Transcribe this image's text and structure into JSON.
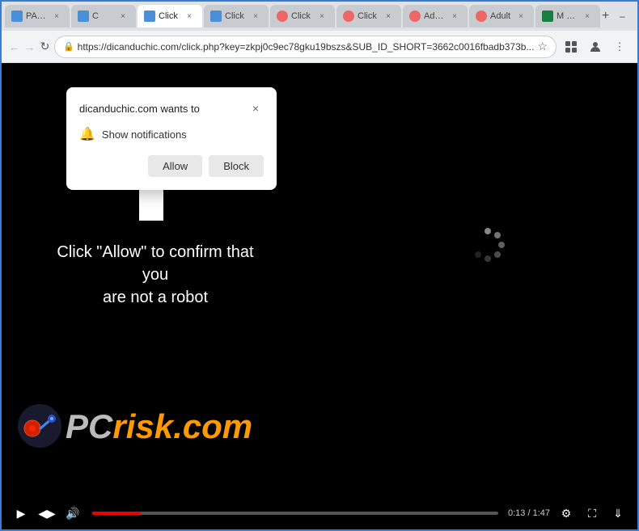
{
  "browser": {
    "tabs": [
      {
        "id": "tab1",
        "label": "PAW N...",
        "favicon_color": "#4a90d9",
        "active": false
      },
      {
        "id": "tab2",
        "label": "C",
        "favicon_color": "#4a90d9",
        "active": false
      },
      {
        "id": "tab3",
        "label": "Click",
        "favicon_color": "#4a90d9",
        "active": true
      },
      {
        "id": "tab4",
        "label": "Click",
        "favicon_color": "#4a90d9",
        "active": false
      },
      {
        "id": "tab5",
        "label": "Click",
        "favicon_color": "#e66",
        "active": false
      },
      {
        "id": "tab6",
        "label": "Click",
        "favicon_color": "#e66",
        "active": false
      },
      {
        "id": "tab7",
        "label": "Adult...",
        "favicon_color": "#e66",
        "active": false
      },
      {
        "id": "tab8",
        "label": "Adult",
        "favicon_color": "#e66",
        "active": false
      },
      {
        "id": "tab9",
        "label": "M Home...",
        "favicon_color": "#1a7f3c",
        "active": false
      }
    ],
    "address": "https://dicanduchic.com/click.php?key=zkpj0c9ec78gku19bszs&SUB_ID_SHORT=3662c0016fbadb373b...",
    "nav": {
      "back_disabled": true,
      "forward_disabled": true
    }
  },
  "popup": {
    "title": "dicanduchic.com wants to",
    "notification_label": "Show notifications",
    "allow_label": "Allow",
    "block_label": "Block"
  },
  "page": {
    "caption_line1": "Click \"Allow\" to confirm that you",
    "caption_line2": "are not a robot"
  },
  "video": {
    "time_current": "0:13",
    "time_total": "1:47",
    "progress_percent": 12
  },
  "logo": {
    "text_pc": "PC",
    "text_risk": "risk",
    "text_dotcom": ".com"
  }
}
